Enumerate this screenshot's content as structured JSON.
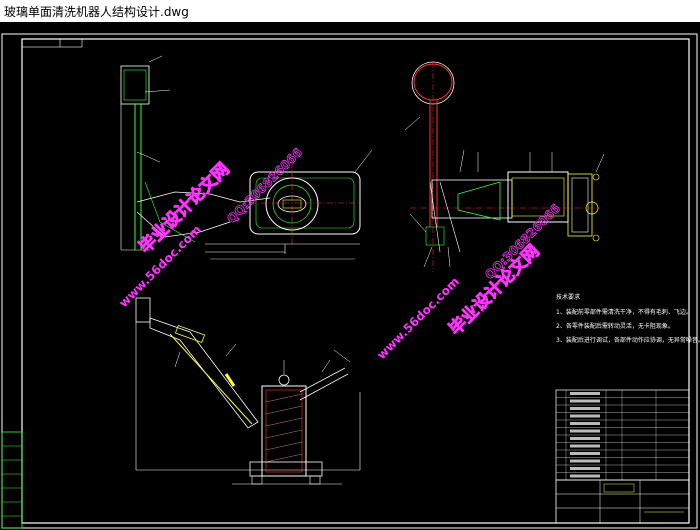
{
  "window": {
    "title": "玻璃单面清洗机器人结构设计.dwg"
  },
  "drawing": {
    "background": "#000000",
    "line_color": "#ffffff",
    "green_color": "#33ff33",
    "yellow_color": "#ffff33",
    "red_color": "#ff3333",
    "magenta_color": "#ff33ff",
    "cyan_color": "#33ffff"
  },
  "watermarks": [
    {
      "text": "毕业设计论文网",
      "color": "#ff33ff"
    },
    {
      "text": "www.56doc.com",
      "color": "#ff33ff"
    },
    {
      "text": "QQ:306826066",
      "color": "#ff33ff"
    },
    {
      "text": "www.56doc.com",
      "color": "#ff33ff"
    },
    {
      "text": "QQ:306826066",
      "color": "#ff33ff"
    },
    {
      "text": "毕业设计论文网",
      "color": "#ff33ff"
    }
  ],
  "notes": {
    "heading": "技术要求",
    "lines": [
      "1、装配前零部件需清洗干净，不得有毛刺、飞边。",
      "2、各零件装配后需转动灵活，无卡阻现象。",
      "3、装配后进行调试，各部件动作应协调，无异常噪音。"
    ]
  }
}
